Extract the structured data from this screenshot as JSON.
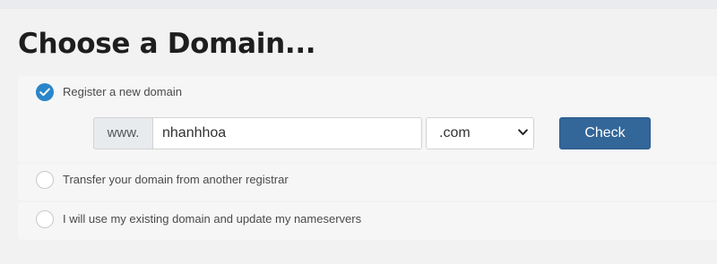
{
  "page": {
    "title": "Choose a Domain..."
  },
  "options": {
    "register": {
      "label": "Register a new domain",
      "selected": true
    },
    "transfer": {
      "label": "Transfer your domain from another registrar",
      "selected": false
    },
    "existing": {
      "label": "I will use my existing domain and update my nameservers",
      "selected": false
    }
  },
  "domain_form": {
    "prefix": "www.",
    "domain_value": "nhanhhoa",
    "tld_selected": ".com",
    "check_label": "Check"
  },
  "colors": {
    "accent": "#2a86c9",
    "button": "#336699",
    "background": "#f2f2f2"
  },
  "icons": {
    "checked_radio": "checkmark-icon",
    "select_arrow": "chevron-down-icon"
  }
}
